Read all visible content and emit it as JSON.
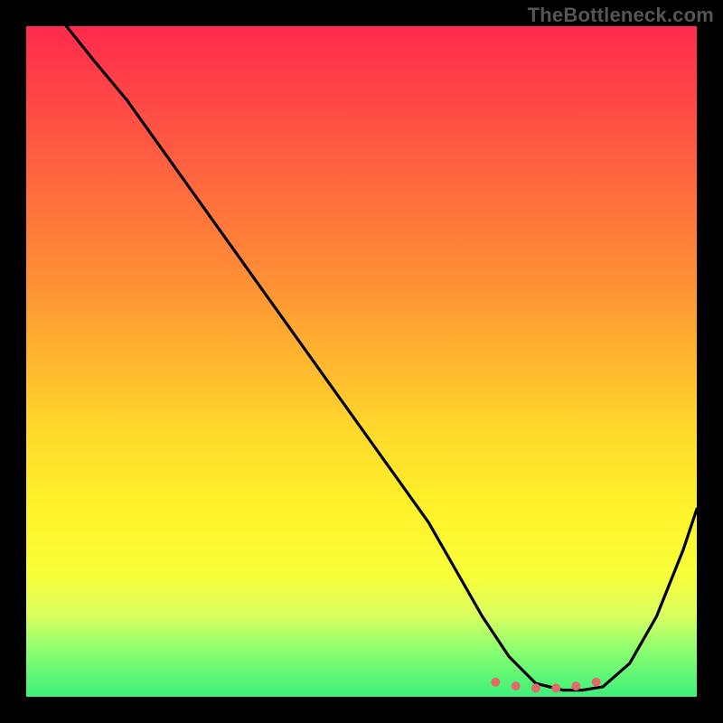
{
  "watermark": "TheBottleneck.com",
  "colors": {
    "background": "#000000",
    "gradient_top": "#ff2a4d",
    "gradient_bottom": "#3cf07a",
    "curve": "#000000",
    "marker": "#e46a6a"
  },
  "chart_data": {
    "type": "line",
    "title": "",
    "xlabel": "",
    "ylabel": "",
    "xlim": [
      0,
      100
    ],
    "ylim": [
      0,
      100
    ],
    "grid": false,
    "legend": false,
    "annotations": [
      "TheBottleneck.com"
    ],
    "series": [
      {
        "name": "bottleneck-curve",
        "x": [
          6,
          10,
          15,
          20,
          25,
          30,
          35,
          40,
          45,
          50,
          55,
          60,
          64,
          68,
          72,
          76,
          80,
          83,
          86,
          90,
          94,
          98,
          100
        ],
        "values": [
          100,
          95,
          89,
          82,
          75,
          68,
          61,
          54,
          47,
          40,
          33,
          26,
          19,
          12,
          6,
          2,
          1,
          1,
          1.5,
          5,
          12,
          22,
          28
        ]
      }
    ],
    "markers": {
      "name": "bottom-highlight",
      "x": [
        70,
        73,
        76,
        79,
        82,
        85
      ],
      "values": [
        2.2,
        1.6,
        1.3,
        1.3,
        1.6,
        2.2
      ]
    }
  }
}
